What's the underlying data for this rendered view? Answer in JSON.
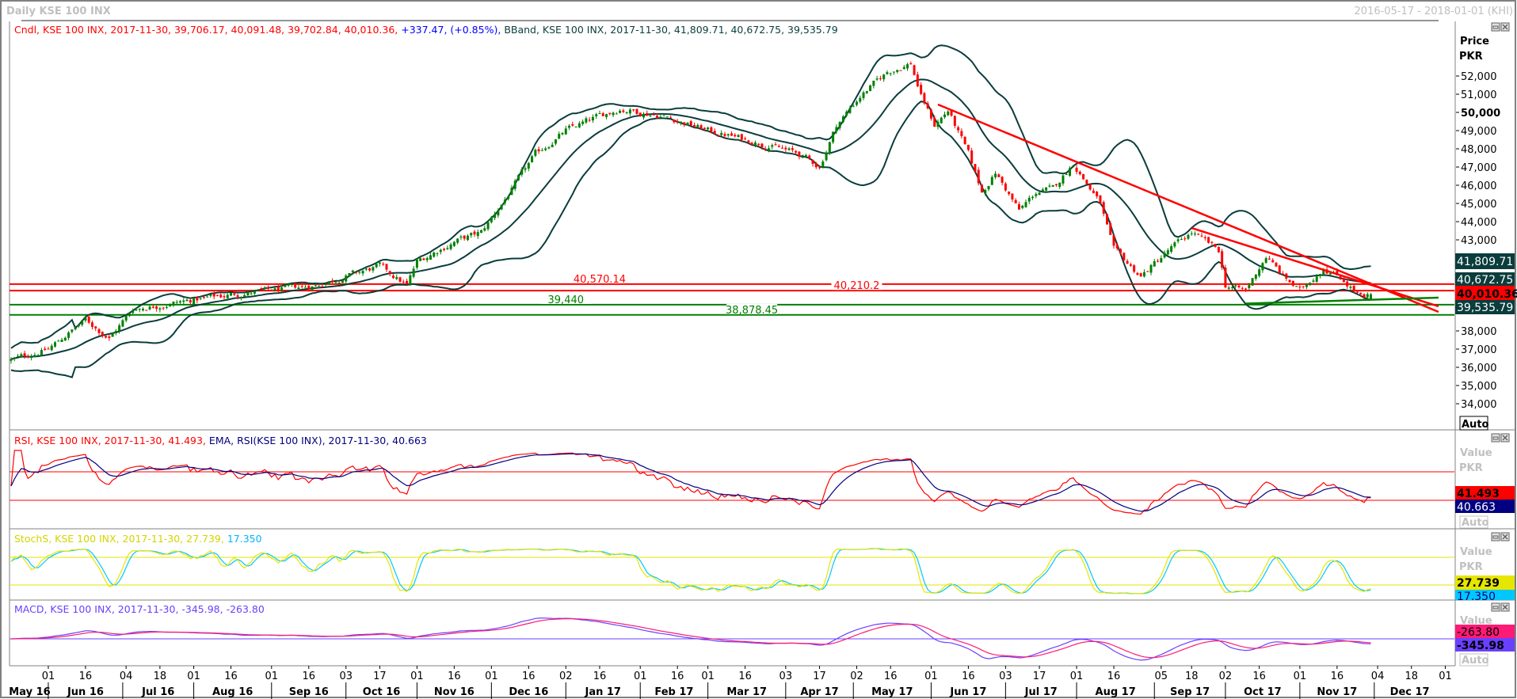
{
  "window": {
    "title": "Daily KSE 100 INX",
    "date_range": "2016-05-17 - 2018-01-01 (KHI)"
  },
  "main_legend": {
    "candle": "Cndl, KSE 100 INX, 2017-11-30, 39,706.17, 40,091.48, 39,702.84, 40,010.36,",
    "change": "+337.47, (+0.85%),",
    "bband": "BBand, KSE 100 INX, 2017-11-30, 41,809.71, 40,672.75, 39,535.79"
  },
  "price_axis": {
    "title": "Price",
    "unit": "PKR",
    "auto": "Auto",
    "ticks": [
      {
        "v": 52000,
        "label": "52,000"
      },
      {
        "v": 51000,
        "label": "51,000"
      },
      {
        "v": 50000,
        "label": "50,000",
        "bold": true
      },
      {
        "v": 49000,
        "label": "49,000"
      },
      {
        "v": 48000,
        "label": "48,000"
      },
      {
        "v": 47000,
        "label": "47,000"
      },
      {
        "v": 46000,
        "label": "46,000"
      },
      {
        "v": 45000,
        "label": "45,000"
      },
      {
        "v": 44000,
        "label": "44,000"
      },
      {
        "v": 43000,
        "label": "43,000"
      },
      {
        "v": 38000,
        "label": "38,000"
      },
      {
        "v": 37000,
        "label": "37,000"
      },
      {
        "v": 36000,
        "label": "36,000"
      },
      {
        "v": 35000,
        "label": "35,000"
      },
      {
        "v": 34000,
        "label": "34,000"
      }
    ],
    "value_labels": {
      "bb_upper": "41,809.71",
      "bb_mid": "40,672.75",
      "close": "40,010.36",
      "bb_lower": "39,535.79"
    }
  },
  "hlines": [
    {
      "price": 40570.14,
      "label": "40,570.14",
      "color": "#ff0000",
      "label_date": "2017-01-16"
    },
    {
      "price": 40210.2,
      "label": "40,210.2",
      "color": "#ff0000",
      "label_date": "2017-05-02"
    },
    {
      "price": 39440,
      "label": "39,440",
      "color": "#008000",
      "label_date": "2017-01-02"
    },
    {
      "price": 38878.45,
      "label": "38,878.45",
      "color": "#008000",
      "label_date": "2017-03-20"
    }
  ],
  "trendlines": [
    {
      "from": {
        "date": "2017-06-05",
        "price": 50435
      },
      "to": {
        "date": "2017-12-28",
        "price": 39043
      },
      "color": "#ff0000"
    },
    {
      "from": {
        "date": "2017-09-18",
        "price": 43652
      },
      "to": {
        "date": "2017-12-28",
        "price": 39348
      },
      "color": "#ff0000"
    },
    {
      "from": {
        "date": "2017-10-10",
        "price": 39500
      },
      "to": {
        "date": "2017-12-28",
        "price": 39826
      },
      "color": "#008000"
    }
  ],
  "rsi_panel": {
    "legend_rsi": "RSI, KSE 100 INX, 2017-11-30, 41.493,",
    "legend_ema": "EMA, RSI(KSE 100 INX), 2017-11-30, 40.663",
    "axis_title": "Value",
    "unit": "PKR",
    "rsi_value": "41.493",
    "ema_value": "40.663",
    "auto": "Auto",
    "upper": 70,
    "lower": 30
  },
  "stoch_panel": {
    "legend_k": "StochS, KSE 100 INX, 2017-11-30, 27.739,",
    "legend_d": "17.350",
    "axis_title": "Value",
    "unit": "PKR",
    "k_value": "27.739",
    "d_value": "17.350",
    "upper": 80,
    "lower": 20
  },
  "macd_panel": {
    "legend": "MACD, KSE 100 INX, 2017-11-30, -345.98, -263.80",
    "axis_title": "Value",
    "signal_value": "-263.80",
    "macd_value": "-345.98",
    "auto": "Auto"
  },
  "x_axis": {
    "days": [
      {
        "d": "01",
        "date": "2016-06-01"
      },
      {
        "d": "16",
        "date": "2016-06-16"
      },
      {
        "d": "04",
        "date": "2016-07-04"
      },
      {
        "d": "18",
        "date": "2016-07-18"
      },
      {
        "d": "01",
        "date": "2016-08-01"
      },
      {
        "d": "16",
        "date": "2016-08-16"
      },
      {
        "d": "01",
        "date": "2016-09-01"
      },
      {
        "d": "16",
        "date": "2016-09-16"
      },
      {
        "d": "03",
        "date": "2016-10-03"
      },
      {
        "d": "17",
        "date": "2016-10-17"
      },
      {
        "d": "01",
        "date": "2016-11-01"
      },
      {
        "d": "16",
        "date": "2016-11-16"
      },
      {
        "d": "01",
        "date": "2016-12-01"
      },
      {
        "d": "16",
        "date": "2016-12-16"
      },
      {
        "d": "02",
        "date": "2017-01-02"
      },
      {
        "d": "16",
        "date": "2017-01-16"
      },
      {
        "d": "01",
        "date": "2017-02-01"
      },
      {
        "d": "16",
        "date": "2017-02-16"
      },
      {
        "d": "01",
        "date": "2017-03-01"
      },
      {
        "d": "16",
        "date": "2017-03-16"
      },
      {
        "d": "03",
        "date": "2017-04-03"
      },
      {
        "d": "17",
        "date": "2017-04-17"
      },
      {
        "d": "02",
        "date": "2017-05-02"
      },
      {
        "d": "16",
        "date": "2017-05-16"
      },
      {
        "d": "01",
        "date": "2017-06-01"
      },
      {
        "d": "16",
        "date": "2017-06-16"
      },
      {
        "d": "03",
        "date": "2017-07-03"
      },
      {
        "d": "17",
        "date": "2017-07-17"
      },
      {
        "d": "01",
        "date": "2017-08-01"
      },
      {
        "d": "16",
        "date": "2017-08-16"
      },
      {
        "d": "05",
        "date": "2017-09-05"
      },
      {
        "d": "18",
        "date": "2017-09-18"
      },
      {
        "d": "02",
        "date": "2017-10-02"
      },
      {
        "d": "16",
        "date": "2017-10-16"
      },
      {
        "d": "01",
        "date": "2017-11-01"
      },
      {
        "d": "16",
        "date": "2017-11-16"
      },
      {
        "d": "04",
        "date": "2017-12-04"
      },
      {
        "d": "18",
        "date": "2017-12-18"
      },
      {
        "d": "01",
        "date": "2018-01-01"
      }
    ],
    "months": [
      {
        "label": "May 16",
        "start": "2016-05-17"
      },
      {
        "label": "Jun 16",
        "start": "2016-06-01"
      },
      {
        "label": "Jul 16",
        "start": "2016-07-01"
      },
      {
        "label": "Aug 16",
        "start": "2016-08-01"
      },
      {
        "label": "Sep 16",
        "start": "2016-09-01"
      },
      {
        "label": "Oct 16",
        "start": "2016-10-01"
      },
      {
        "label": "Nov 16",
        "start": "2016-11-01"
      },
      {
        "label": "Dec 16",
        "start": "2016-12-01"
      },
      {
        "label": "Jan 17",
        "start": "2017-01-01"
      },
      {
        "label": "Feb 17",
        "start": "2017-02-01"
      },
      {
        "label": "Mar 17",
        "start": "2017-03-01"
      },
      {
        "label": "Apr 17",
        "start": "2017-04-01"
      },
      {
        "label": "May 17",
        "start": "2017-05-01"
      },
      {
        "label": "Jun 17",
        "start": "2017-06-01"
      },
      {
        "label": "Jul 17",
        "start": "2017-07-01"
      },
      {
        "label": "Aug 17",
        "start": "2017-08-01"
      },
      {
        "label": "Sep 17",
        "start": "2017-09-01"
      },
      {
        "label": "Oct 17",
        "start": "2017-10-01"
      },
      {
        "label": "Nov 17",
        "start": "2017-11-01"
      },
      {
        "label": "Dec 17",
        "start": "2017-12-01"
      }
    ],
    "end": "2018-01-01"
  },
  "colors": {
    "up": "#008000",
    "down": "#ff0000",
    "band": "#0b3d3d",
    "rsi": "#ff0000",
    "rsi_ema": "#000080",
    "stoch_k": "#e6e600",
    "stoch_d": "#00c8ff",
    "macd": "#6a40ff",
    "signal": "#ff1a75"
  },
  "chart_data": {
    "type": "candlestick",
    "title": "Daily KSE 100 INX",
    "ylabel": "Price PKR",
    "ylim": [
      33500,
      53800
    ],
    "last_bar": {
      "date": "2017-11-30",
      "open": 39706.17,
      "high": 40091.48,
      "low": 39702.84,
      "close": 40010.36,
      "change": 337.47,
      "change_pct": 0.85
    },
    "bband_last": {
      "upper": 41809.71,
      "mid": 40672.75,
      "lower": 39535.79
    },
    "close_anchors": [
      [
        "2016-05-17",
        36400
      ],
      [
        "2016-06-01",
        37000
      ],
      [
        "2016-06-16",
        38600
      ],
      [
        "2016-06-27",
        37600
      ],
      [
        "2016-07-06",
        39200
      ],
      [
        "2016-08-01",
        39700
      ],
      [
        "2016-08-16",
        40000
      ],
      [
        "2016-09-01",
        40200
      ],
      [
        "2016-09-20",
        40500
      ],
      [
        "2016-10-17",
        41550
      ],
      [
        "2016-10-27",
        40500
      ],
      [
        "2016-11-01",
        41800
      ],
      [
        "2016-11-16",
        42900
      ],
      [
        "2016-11-28",
        43400
      ],
      [
        "2016-12-08",
        45500
      ],
      [
        "2016-12-20",
        47700
      ],
      [
        "2017-01-02",
        49000
      ],
      [
        "2017-01-16",
        49800
      ],
      [
        "2017-01-24",
        50200
      ],
      [
        "2017-02-10",
        49800
      ],
      [
        "2017-03-01",
        49000
      ],
      [
        "2017-03-25",
        48200
      ],
      [
        "2017-04-07",
        47700
      ],
      [
        "2017-04-17",
        47000
      ],
      [
        "2017-04-22",
        49300
      ],
      [
        "2017-05-03",
        50900
      ],
      [
        "2017-05-14",
        52200
      ],
      [
        "2017-05-24",
        52700
      ],
      [
        "2017-05-29",
        50900
      ],
      [
        "2017-06-02",
        49300
      ],
      [
        "2017-06-08",
        50100
      ],
      [
        "2017-06-16",
        47700
      ],
      [
        "2017-06-22",
        45600
      ],
      [
        "2017-06-28",
        46700
      ],
      [
        "2017-07-07",
        44600
      ],
      [
        "2017-07-14",
        45600
      ],
      [
        "2017-07-21",
        45800
      ],
      [
        "2017-07-31",
        47200
      ],
      [
        "2017-08-10",
        45000
      ],
      [
        "2017-08-16",
        42400
      ],
      [
        "2017-08-28",
        41000
      ],
      [
        "2017-09-07",
        42400
      ],
      [
        "2017-09-18",
        43400
      ],
      [
        "2017-09-28",
        42400
      ],
      [
        "2017-10-02",
        40500
      ],
      [
        "2017-10-10",
        40200
      ],
      [
        "2017-10-18",
        42100
      ],
      [
        "2017-10-25",
        41000
      ],
      [
        "2017-11-01",
        40200
      ],
      [
        "2017-11-10",
        41500
      ],
      [
        "2017-11-20",
        40800
      ],
      [
        "2017-11-28",
        39700
      ],
      [
        "2017-11-30",
        40010.36
      ]
    ]
  }
}
